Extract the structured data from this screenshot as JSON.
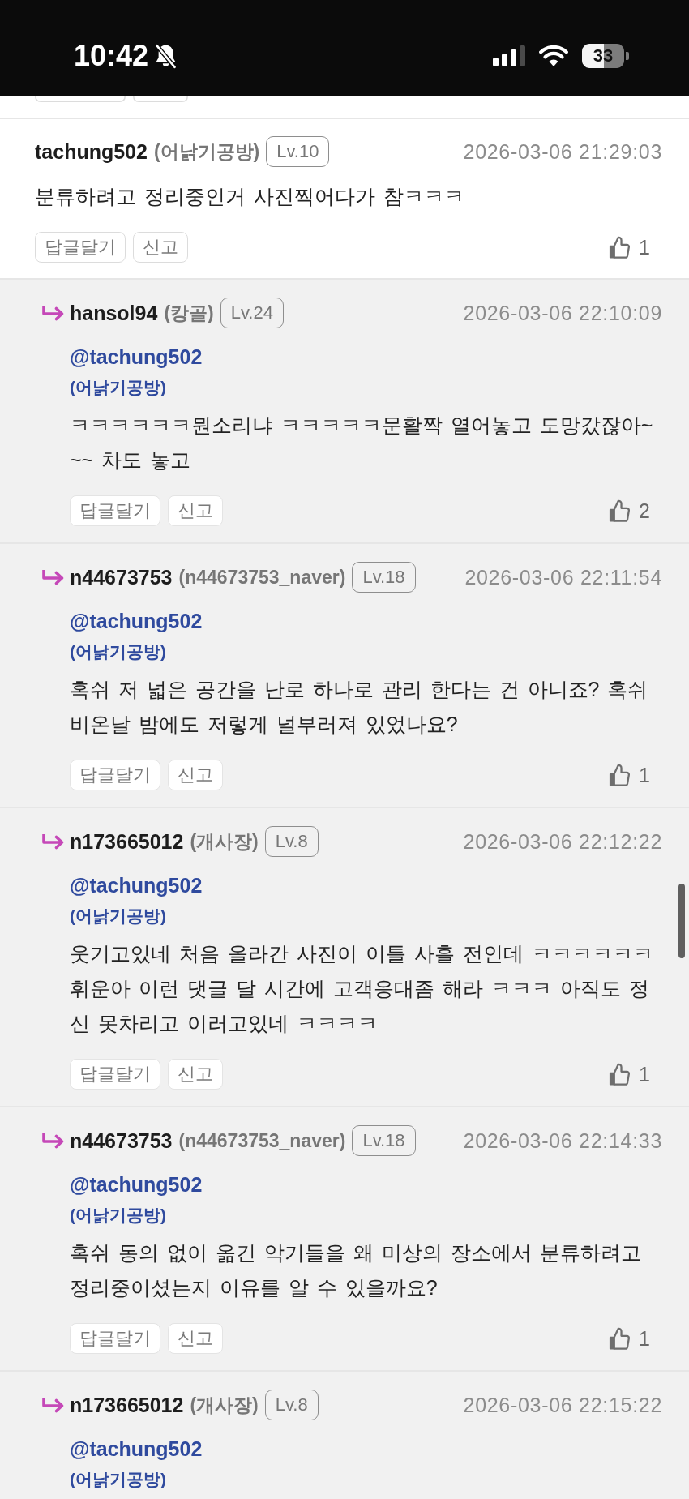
{
  "status_bar": {
    "time": "10:42",
    "silent_mode": true,
    "battery": "33"
  },
  "comments": [
    {
      "kind": "comment",
      "username": "tachung502",
      "nickname": "(어낡기공방)",
      "level": "Lv.10",
      "date": "2026-03-06 21:29:03",
      "text": "분류하려고 정리중인거 사진찍어다가 참ㅋㅋㅋ",
      "buttons": [
        "답글달기",
        "신고"
      ],
      "likes": "1"
    },
    {
      "kind": "reply",
      "username": "hansol94",
      "nickname": "(캉골)",
      "level": "Lv.24",
      "date": "2026-03-06 22:10:09",
      "mention": "@tachung502",
      "mention_nickname": "(어낡기공방)",
      "text": "ㅋㅋㅋㅋㅋㅋ뭔소리냐 ㅋㅋㅋㅋㅋ문활짝 열어놓고 도망갔잖아~~~ 차도 놓고",
      "buttons": [
        "답글달기",
        "신고"
      ],
      "likes": "2"
    },
    {
      "kind": "reply",
      "username": "n44673753",
      "nickname": "(n44673753_naver)",
      "level": "Lv.18",
      "date": "2026-03-06 22:11:54",
      "mention": "@tachung502",
      "mention_nickname": "(어낡기공방)",
      "text": "혹쉬 저 넓은 공간을 난로 하나로 관리 한다는 건 아니죠? 혹쉬 비온날 밤에도 저렇게 널부러져 있었나요?",
      "buttons": [
        "답글달기",
        "신고"
      ],
      "likes": "1"
    },
    {
      "kind": "reply",
      "username": "n173665012",
      "nickname": "(개사장)",
      "level": "Lv.8",
      "date": "2026-03-06 22:12:22",
      "mention": "@tachung502",
      "mention_nickname": "(어낡기공방)",
      "text": "웃기고있네 처음 올라간 사진이 이틀 사흘 전인데 ㅋㅋㅋㅋㅋㅋ 휘운아 이런 댓글 달 시간에 고객응대좀 해라 ㅋㅋㅋ 아직도 정신 못차리고 이러고있네 ㅋㅋㅋㅋ",
      "buttons": [
        "답글달기",
        "신고"
      ],
      "likes": "1"
    },
    {
      "kind": "reply",
      "username": "n44673753",
      "nickname": "(n44673753_naver)",
      "level": "Lv.18",
      "date": "2026-03-06 22:14:33",
      "mention": "@tachung502",
      "mention_nickname": "(어낡기공방)",
      "text": "혹쉬 동의 없이 옮긴 악기들을 왜 미상의 장소에서 분류하려고 정리중이셨는지 이유를 알 수 있을까요?",
      "buttons": [
        "답글달기",
        "신고"
      ],
      "likes": "1"
    },
    {
      "kind": "reply",
      "username": "n173665012",
      "nickname": "(개사장)",
      "level": "Lv.8",
      "date": "2026-03-06 22:15:22",
      "mention": "@tachung502",
      "mention_nickname": "(어낡기공방)"
    }
  ]
}
